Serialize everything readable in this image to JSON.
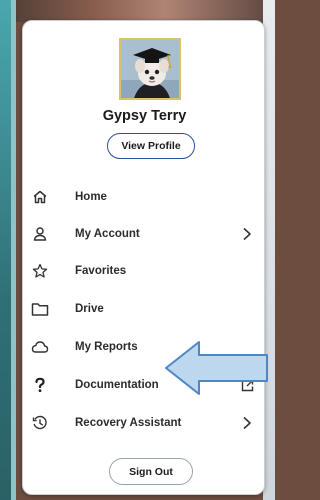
{
  "profile": {
    "name": "Gypsy Terry",
    "view_profile_label": "View Profile"
  },
  "menu": {
    "items": [
      {
        "label": "Home",
        "icon": "home-icon"
      },
      {
        "label": "My Account",
        "icon": "person-icon",
        "trailing": "chevron-right-icon"
      },
      {
        "label": "Favorites",
        "icon": "star-icon"
      },
      {
        "label": "Drive",
        "icon": "folder-icon"
      },
      {
        "label": "My Reports",
        "icon": "cloud-icon"
      },
      {
        "label": "Documentation",
        "icon": "question-icon",
        "trailing": "external-link-icon"
      },
      {
        "label": "Recovery Assistant",
        "icon": "history-icon",
        "trailing": "chevron-right-icon"
      }
    ]
  },
  "sign_out_label": "Sign Out",
  "colors": {
    "callout_fill": "#bcd7ee",
    "callout_stroke": "#4f86c4",
    "view_profile_border": "#2a4f9a"
  }
}
